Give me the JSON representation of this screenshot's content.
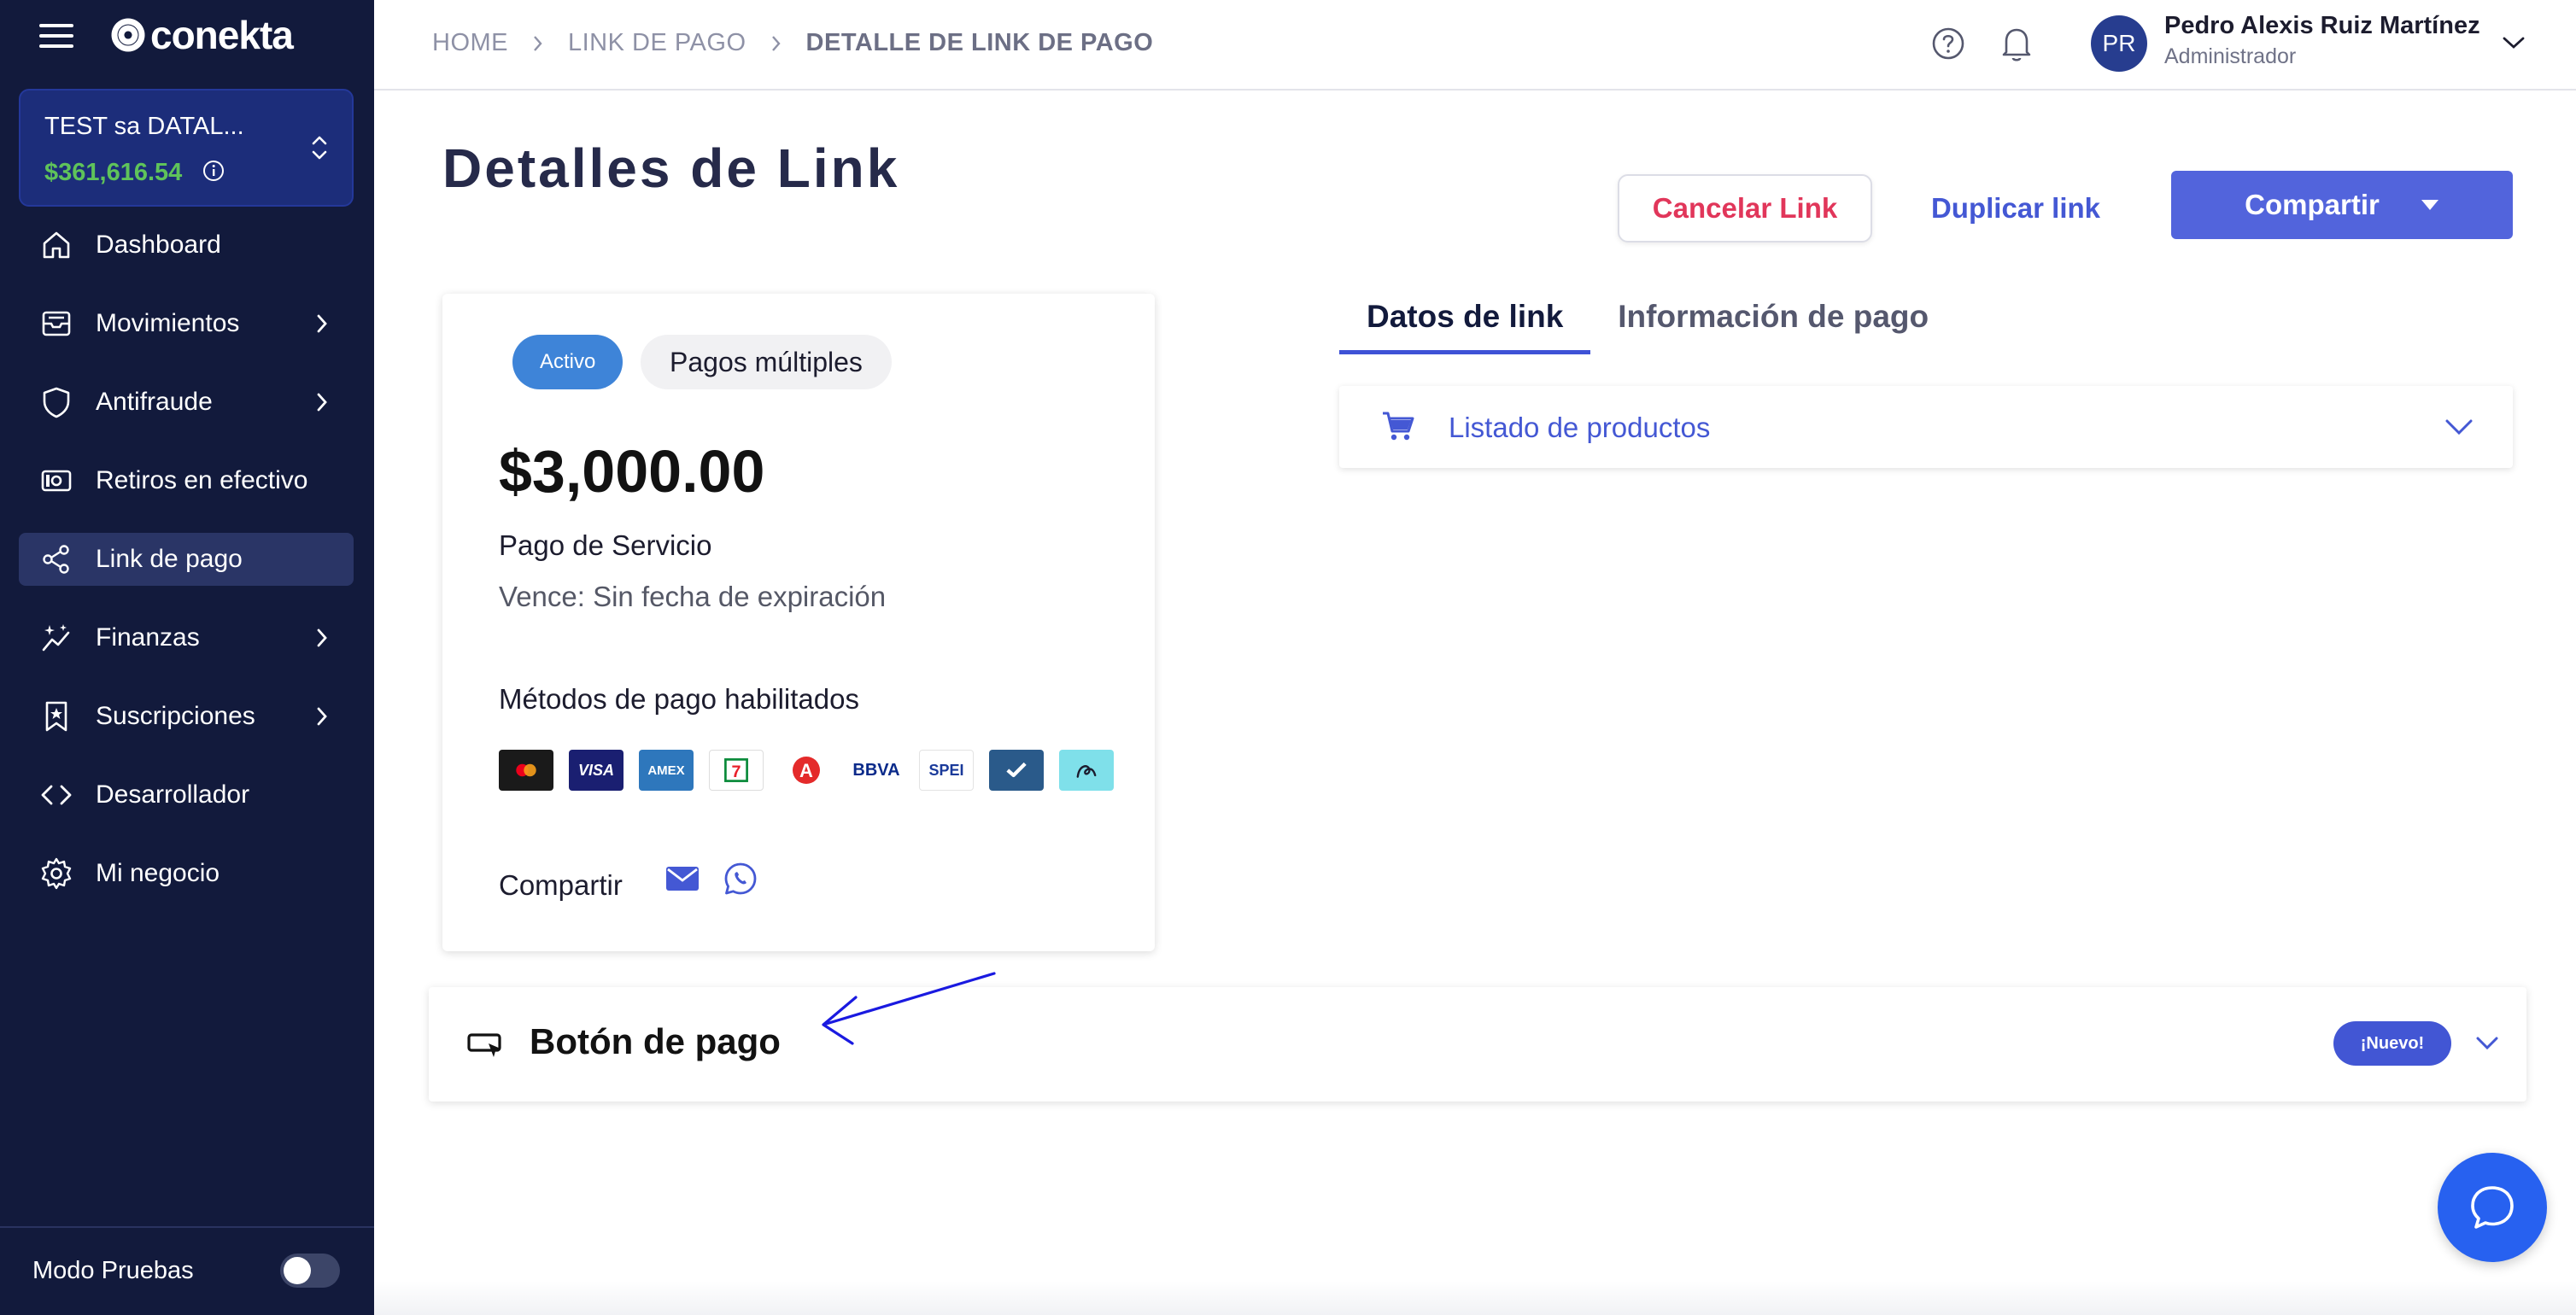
{
  "brand": {
    "name": "conekta"
  },
  "account": {
    "name": "TEST sa DATAL...",
    "balance": "$361,616.54"
  },
  "sidebar": {
    "items": [
      {
        "label": "Dashboard",
        "icon": "home-icon",
        "has_submenu": false,
        "active": false
      },
      {
        "label": "Movimientos",
        "icon": "inbox-icon",
        "has_submenu": true,
        "active": false
      },
      {
        "label": "Antifraude",
        "icon": "shield-icon",
        "has_submenu": true,
        "active": false
      },
      {
        "label": "Retiros en efectivo",
        "icon": "cash-icon",
        "has_submenu": false,
        "active": false
      },
      {
        "label": "Link de pago",
        "icon": "share-icon",
        "has_submenu": false,
        "active": true
      },
      {
        "label": "Finanzas",
        "icon": "sparkle-chart-icon",
        "has_submenu": true,
        "active": false
      },
      {
        "label": "Suscripciones",
        "icon": "bookmark-star-icon",
        "has_submenu": true,
        "active": false
      },
      {
        "label": "Desarrollador",
        "icon": "code-icon",
        "has_submenu": false,
        "active": false
      },
      {
        "label": "Mi negocio",
        "icon": "gear-icon",
        "has_submenu": false,
        "active": false
      }
    ],
    "footer": {
      "label": "Modo Pruebas",
      "toggle_on": false
    }
  },
  "breadcrumb": {
    "items": [
      "HOME",
      "LINK DE PAGO"
    ],
    "current": "DETALLE DE LINK DE PAGO"
  },
  "user": {
    "initials": "PR",
    "name": "Pedro Alexis Ruiz Martínez",
    "role": "Administrador"
  },
  "page": {
    "title": "Detalles de Link"
  },
  "actions": {
    "cancel": "Cancelar Link",
    "duplicate": "Duplicar link",
    "share": "Compartir"
  },
  "link_card": {
    "status": "Activo",
    "type": "Pagos múltiples",
    "amount": "$3,000.00",
    "concept": "Pago de Servicio",
    "expiry": "Vence: Sin fecha de expiración",
    "methods_label": "Métodos de pago habilitados",
    "methods": [
      "Mastercard",
      "VISA",
      "AMEX",
      "7-Eleven",
      "Farmacias del Ahorro",
      "BBVA",
      "SPEI",
      "Banorte",
      "Aplazo"
    ],
    "share_label": "Compartir"
  },
  "tabs": [
    {
      "label": "Datos de link",
      "active": true
    },
    {
      "label": "Información de pago",
      "active": false
    }
  ],
  "products": {
    "label": "Listado de productos"
  },
  "payment_button": {
    "label": "Botón de pago",
    "badge": "¡Nuevo!"
  },
  "colors": {
    "sidebar_bg": "#121a3c",
    "primary": "#5264dc",
    "danger": "#e1365a",
    "balance_green": "#5fc35a",
    "chat": "#2761f0"
  }
}
